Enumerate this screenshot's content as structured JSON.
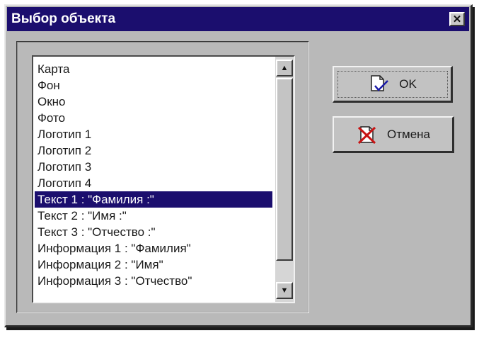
{
  "window": {
    "title": "Выбор объекта",
    "close_symbol": "✕"
  },
  "list": {
    "items": [
      "Карта",
      "Фон",
      "Окно",
      "Фото",
      "Логотип 1",
      "Логотип 2",
      "Логотип 3",
      "Логотип 4",
      "Текст 1 : \"Фамилия :\"",
      "Текст 2 : \"Имя :\"",
      "Текст 3 : \"Отчество :\"",
      "Информация 1 : \"Фамилия\"",
      "Информация 2 : \"Имя\"",
      "Информация 3 : \"Отчество\""
    ],
    "selected_index": 8
  },
  "scrollbar": {
    "up_icon": "▲",
    "down_icon": "▼"
  },
  "buttons": {
    "ok_label": "OK",
    "cancel_label": "Отмена"
  },
  "colors": {
    "title_bar": "#1b0e6e",
    "selection": "#1b0e6e",
    "dialog_bg": "#b9b9b9"
  },
  "icons": {
    "ok": "document-check-icon",
    "cancel": "document-cross-icon"
  }
}
